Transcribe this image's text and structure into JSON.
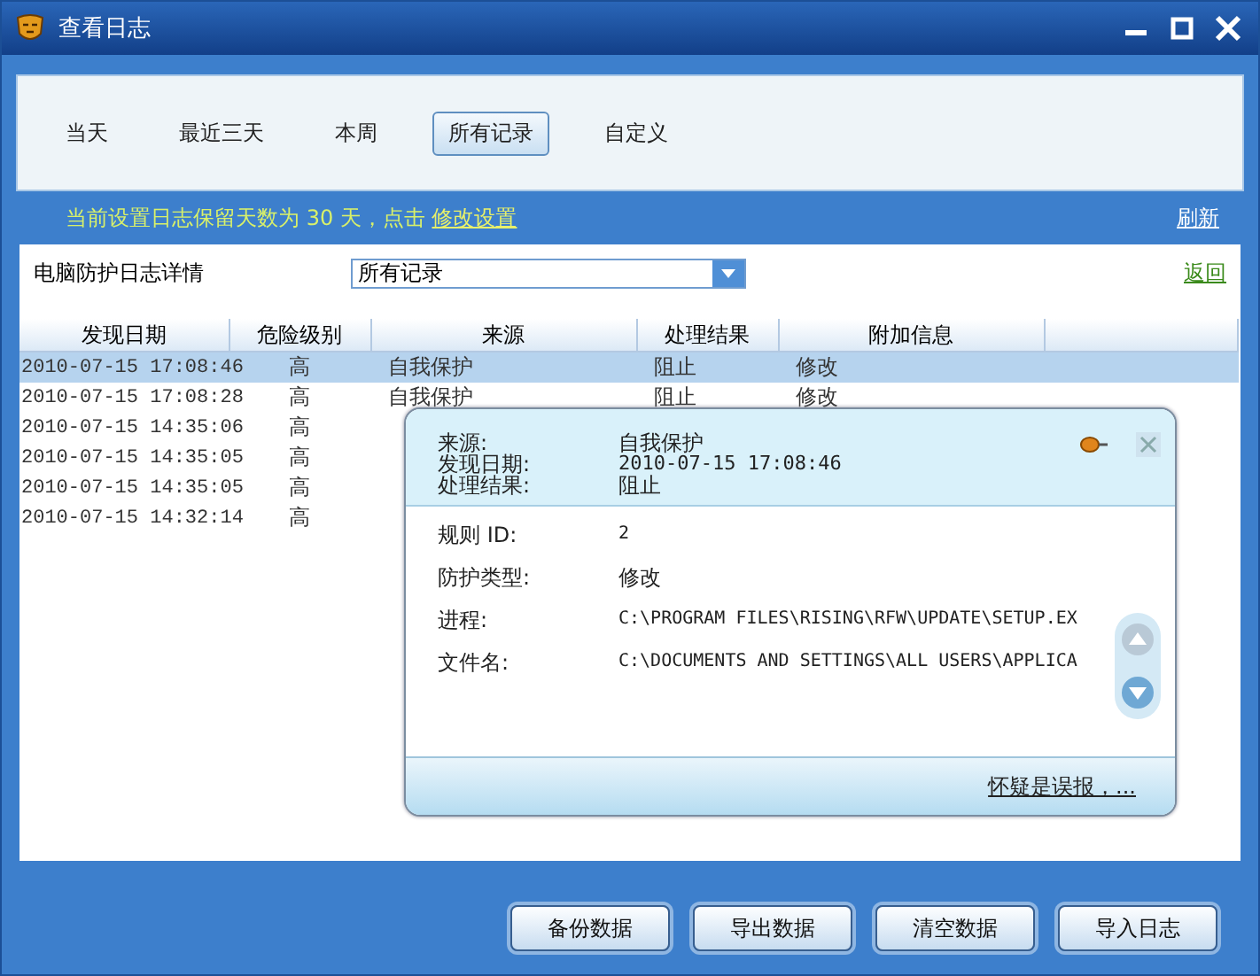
{
  "window": {
    "title": "查看日志"
  },
  "period_tabs": [
    {
      "label": "当天",
      "selected": false
    },
    {
      "label": "最近三天",
      "selected": false
    },
    {
      "label": "本周",
      "selected": false
    },
    {
      "label": "所有记录",
      "selected": true
    },
    {
      "label": "自定义",
      "selected": false
    }
  ],
  "retention_notice": {
    "text": "当前设置日志保留天数为 30 天，点击",
    "link": "修改设置"
  },
  "refresh_link": "刷新",
  "section_title": "电脑防护日志详情",
  "filter": {
    "value": "所有记录"
  },
  "back_link": "返回",
  "table": {
    "columns": [
      "发现日期",
      "危险级别",
      "来源",
      "处理结果",
      "附加信息"
    ],
    "rows": [
      {
        "selected": true,
        "cells": [
          "2010-07-15 17:08:46",
          "高",
          "自我保护",
          "阻止",
          "修改"
        ]
      },
      {
        "selected": false,
        "cells": [
          "2010-07-15 17:08:28",
          "高",
          "自我保护",
          "阻止",
          "修改"
        ]
      },
      {
        "selected": false,
        "cells": [
          "2010-07-15 14:35:06",
          "高"
        ]
      },
      {
        "selected": false,
        "cells": [
          "2010-07-15 14:35:05",
          "高"
        ]
      },
      {
        "selected": false,
        "cells": [
          "2010-07-15 14:35:05",
          "高"
        ]
      },
      {
        "selected": false,
        "cells": [
          "2010-07-15 14:32:14",
          "高"
        ]
      }
    ]
  },
  "detail_popup": {
    "header_fields": [
      {
        "label": "来源:",
        "value": "自我保护"
      },
      {
        "label": "发现日期:",
        "value": "2010-07-15 17:08:46"
      },
      {
        "label": "处理结果:",
        "value": "阻止"
      }
    ],
    "fields": [
      {
        "label": "规则 ID:",
        "value": "2"
      },
      {
        "label": "防护类型:",
        "value": "修改"
      },
      {
        "label": "进程:",
        "value": "C:\\PROGRAM FILES\\RISING\\RFW\\UPDATE\\SETUP.EX"
      },
      {
        "label": "文件名:",
        "value": "C:\\DOCUMENTS AND SETTINGS\\ALL USERS\\APPLICA"
      }
    ],
    "report_link": "怀疑是误报，..."
  },
  "buttons": [
    "备份数据",
    "导出数据",
    "清空数据",
    "导入日志"
  ]
}
